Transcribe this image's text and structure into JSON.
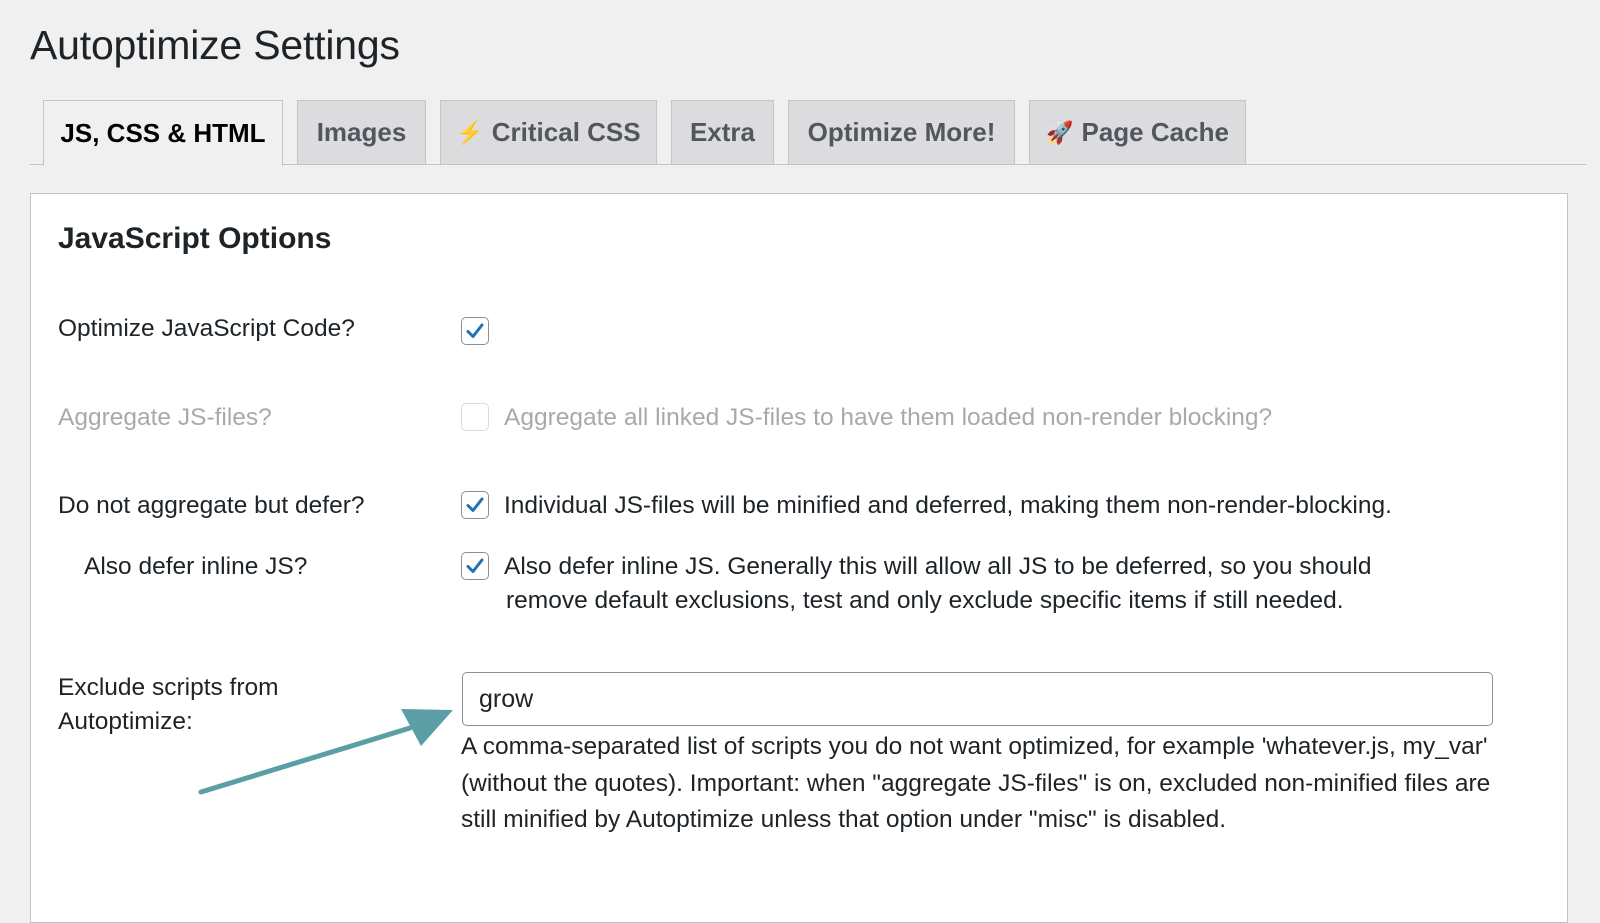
{
  "page": {
    "title": "Autoptimize Settings"
  },
  "tabs": [
    {
      "label": "JS, CSS & HTML",
      "icon": "",
      "active": true
    },
    {
      "label": "Images",
      "icon": "",
      "active": false
    },
    {
      "label": "Critical CSS",
      "icon": "lightning-bolt-icon",
      "glyph": "⚡",
      "active": false
    },
    {
      "label": "Extra",
      "icon": "",
      "active": false
    },
    {
      "label": "Optimize More!",
      "icon": "",
      "active": false
    },
    {
      "label": "Page Cache",
      "icon": "rocket-icon",
      "glyph": "🚀",
      "active": false
    }
  ],
  "section": {
    "title": "JavaScript Options"
  },
  "options": {
    "optimize_js": {
      "label": "Optimize JavaScript Code?",
      "checked": true,
      "description": ""
    },
    "aggregate_js": {
      "label": "Aggregate JS-files?",
      "checked": false,
      "disabled": true,
      "description": "Aggregate all linked JS-files to have them loaded non-render blocking?"
    },
    "defer": {
      "label": "Do not aggregate but defer?",
      "checked": true,
      "description": "Individual JS-files will be minified and deferred, making them non-render-blocking."
    },
    "defer_inline": {
      "label": "Also defer inline JS?",
      "checked": true,
      "description_line1": "Also defer inline JS. Generally this will allow all JS to be deferred, so you should",
      "description_line2": "remove default exclusions, test and only exclude specific items if still needed."
    },
    "exclude": {
      "label_line1": "Exclude scripts from",
      "label_line2": "Autoptimize:",
      "value": "grow",
      "help": "A comma-separated list of scripts you do not want optimized, for example 'whatever.js, my_var' (without the quotes). Important: when \"aggregate JS-files\" is on, excluded non-minified files are still minified by Autoptimize unless that option under \"misc\" is disabled."
    }
  },
  "colors": {
    "background": "#f0f0f1",
    "panel": "#ffffff",
    "checkmark": "#2271b1",
    "arrow": "#5b9ea6",
    "disabled_text": "#a7aaad"
  }
}
